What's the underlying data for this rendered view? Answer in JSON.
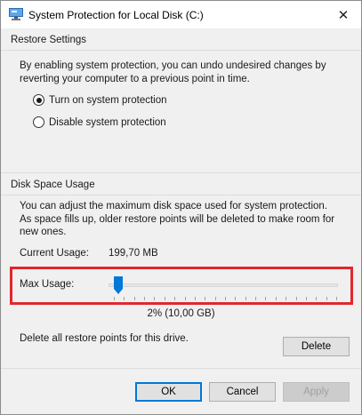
{
  "window": {
    "title": "System Protection for Local Disk (C:)",
    "close_glyph": "✕"
  },
  "restore_settings": {
    "group_label": "Restore Settings",
    "description": "By enabling system protection, you can undo undesired changes by reverting your computer to a previous point in time.",
    "options": [
      {
        "label": "Turn on system protection",
        "checked": true
      },
      {
        "label": "Disable system protection",
        "checked": false
      }
    ]
  },
  "disk_space": {
    "group_label": "Disk Space Usage",
    "description": "You can adjust the maximum disk space used for system protection. As space fills up, older restore points will be deleted to make room for new ones.",
    "current_usage_label": "Current Usage:",
    "current_usage_value": "199,70 MB",
    "max_usage_label": "Max Usage:",
    "max_usage_fraction": 0.02,
    "max_usage_readout": "2% (10,00 GB)",
    "delete_text": "Delete all restore points for this drive.",
    "delete_button": "Delete"
  },
  "footer": {
    "ok": "OK",
    "cancel": "Cancel",
    "apply": "Apply"
  },
  "colors": {
    "highlight": "#e0282e",
    "accent": "#0078d7"
  }
}
